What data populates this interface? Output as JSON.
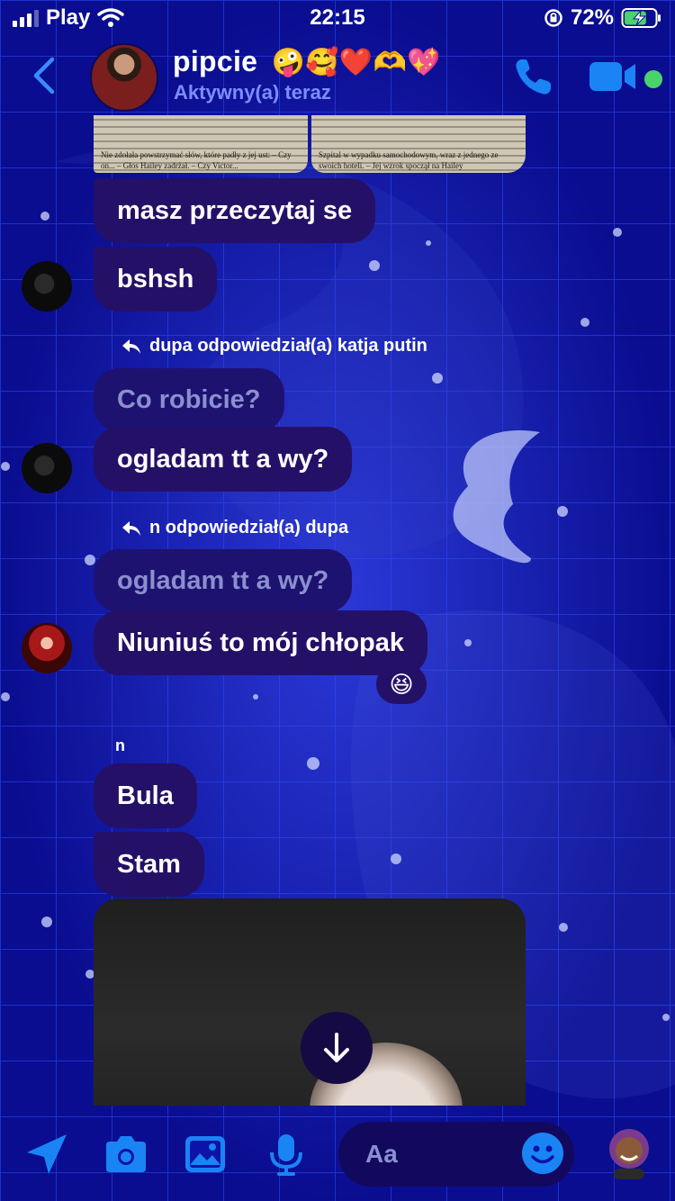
{
  "status_bar": {
    "carrier": "Play",
    "time": "22:15",
    "battery": "72%",
    "battery_level": 0.72
  },
  "header": {
    "contact_name": "pipcie",
    "contact_emojis": "🤪🥰❤️🫶💖",
    "status": "Aktywny(a) teraz"
  },
  "messages": {
    "book_text_left": "Nie zdołała powstrzymać słów, które padły z jej ust: – Czy on... – Głos Hailey zadrżał. – Czy Victor...",
    "book_text_right": "Szpital w wypadku samochodowym, wraz z jednego ze swoich hoteli. – Jej wzrok spoczął na Hailey",
    "m1": "masz przeczytaj se",
    "m2": "bshsh",
    "reply_note_1": "dupa odpowiedział(a) katja putin",
    "quoted_1": "Co robicie?",
    "m3": "ogladam tt a wy?",
    "reply_note_2": "n odpowiedział(a) dupa",
    "quoted_2": "ogladam tt a wy?",
    "m4": "Niuniuś to mój chłopak",
    "reaction": "😆",
    "sender_n": "n",
    "m5": "Bula",
    "m6": "Stam"
  },
  "composer": {
    "placeholder": "Aa"
  },
  "icons": {
    "back": "chevron-left-icon",
    "call": "phone-icon",
    "video": "video-camera-icon",
    "location": "location-arrow-icon",
    "camera": "camera-icon",
    "gallery": "photo-icon",
    "mic": "microphone-icon",
    "emoji": "smiley-icon"
  },
  "colors": {
    "background": "#0e12a8",
    "bubble": "#241066",
    "accent": "#1a84f5",
    "online": "#4ad36a"
  }
}
